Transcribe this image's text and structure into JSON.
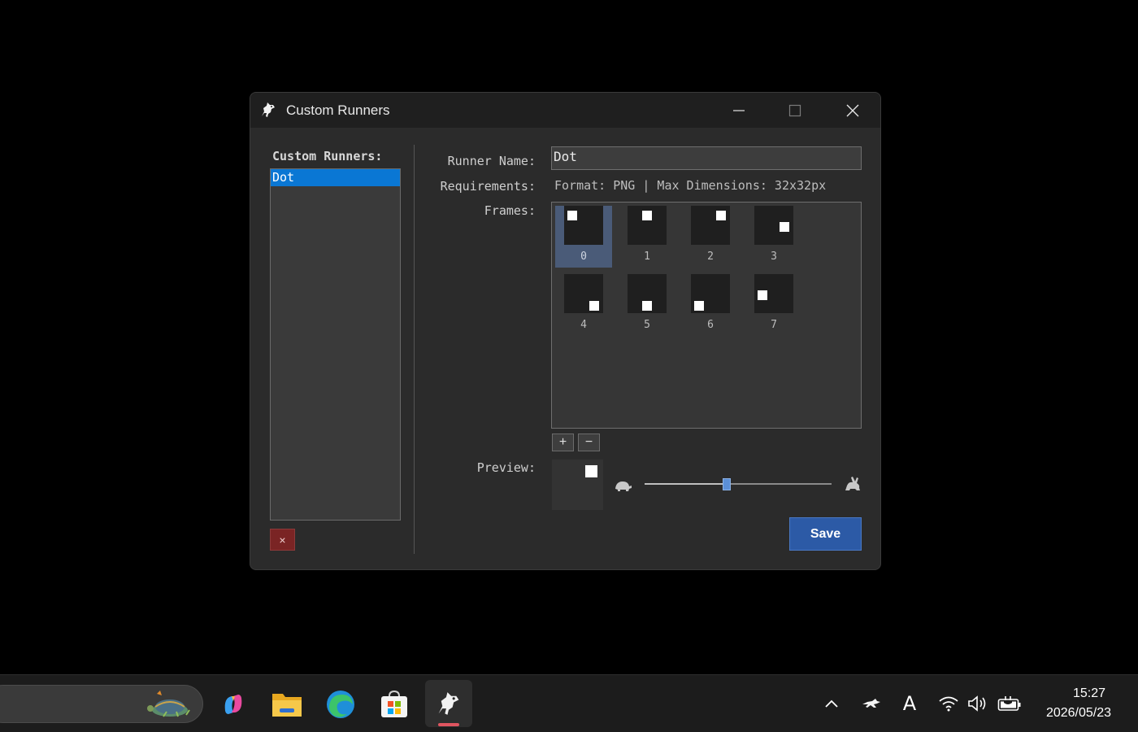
{
  "window": {
    "title": "Custom Runners",
    "controls": {
      "minimize": "minimize",
      "maximize": "maximize",
      "close": "close"
    }
  },
  "left_panel": {
    "title": "Custom Runners:",
    "runners": [
      {
        "label": "Dot",
        "selected": true
      }
    ],
    "delete_label": "×"
  },
  "form": {
    "runner_name_label": "Runner Name:",
    "runner_name_value": "Dot",
    "requirements_label": "Requirements:",
    "requirements_text": "Format: PNG | Max Dimensions: 32x32px",
    "frames_label": "Frames:",
    "frames": [
      {
        "label": "0",
        "selected": true
      },
      {
        "label": "1"
      },
      {
        "label": "2"
      },
      {
        "label": "3"
      },
      {
        "label": "4"
      },
      {
        "label": "5"
      },
      {
        "label": "6"
      },
      {
        "label": "7"
      }
    ],
    "add_frame_label": "+",
    "remove_frame_label": "−",
    "preview_label": "Preview:",
    "speed_slider_value": 0.44,
    "save_label": "Save"
  },
  "taskbar": {
    "apps": [
      "copilot-icon",
      "file-explorer-icon",
      "edge-icon",
      "store-icon",
      "custom-runners-icon"
    ],
    "active_app": "custom-runners-icon",
    "active_indicator_color": "#e05560",
    "tray": [
      "chevron-up-icon",
      "runner-tray-icon",
      "ime-indicator-icon",
      "wifi-icon",
      "volume-icon",
      "battery-icon"
    ],
    "ime_label": "A",
    "time": "15:27",
    "date": "2026/05/23"
  },
  "colors": {
    "selection": "#0a77d4",
    "frame_selected": "#4a5b78",
    "save_button": "#2c5aa6",
    "delete_button": "#7a2424",
    "slider_thumb": "#5b8fd6"
  }
}
